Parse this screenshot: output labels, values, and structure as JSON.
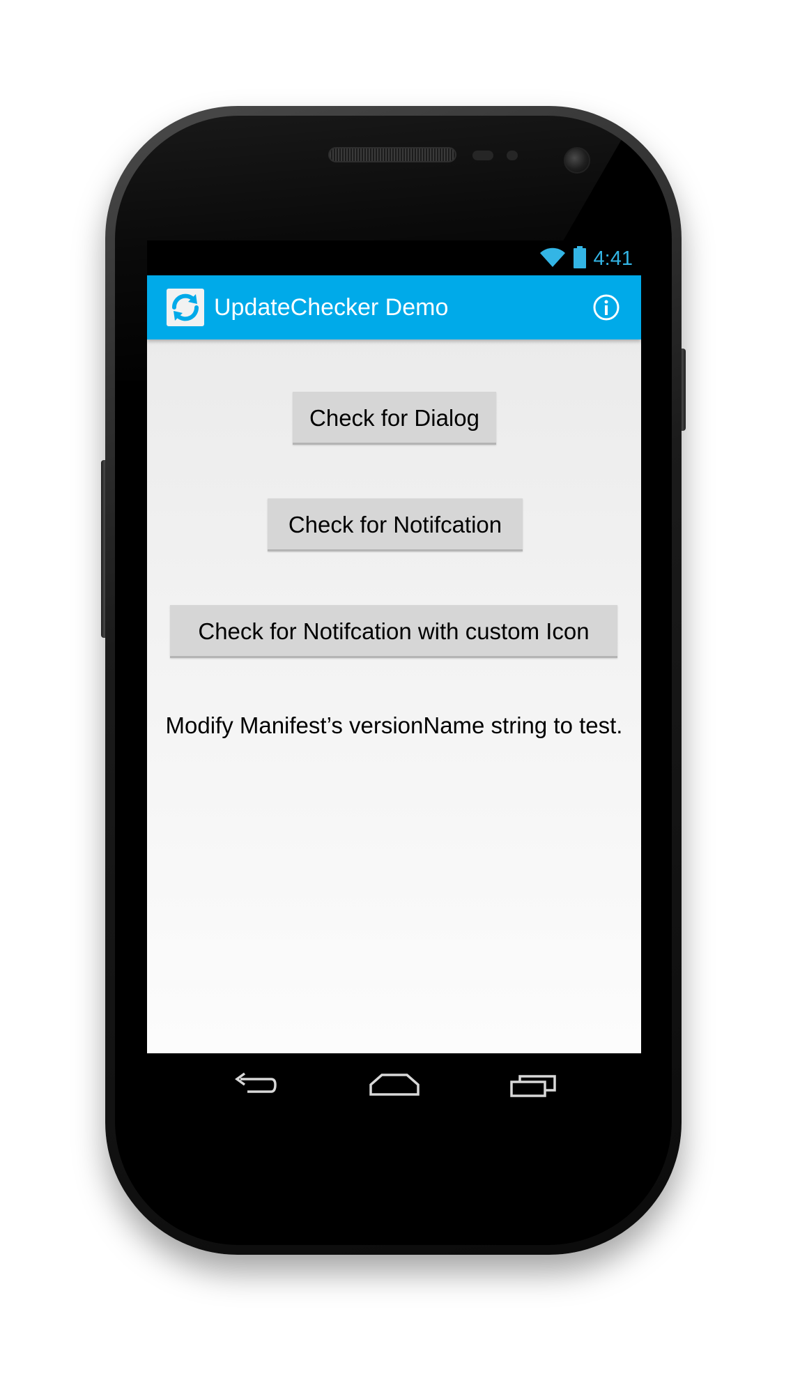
{
  "status_bar": {
    "time": "4:41",
    "icons": [
      "wifi-icon",
      "battery-icon"
    ],
    "accent_color": "#33b5e5"
  },
  "action_bar": {
    "title": "UpdateChecker Demo",
    "app_icon": "refresh-icon",
    "action_icon": "info-icon",
    "color": "#00aae9"
  },
  "main": {
    "buttons": [
      {
        "label": "Check for Dialog"
      },
      {
        "label": "Check for Notifcation"
      },
      {
        "label": "Check for Notifcation with custom Icon"
      }
    ],
    "hint": "Modify Manifest’s versionName string to test."
  },
  "nav_bar": {
    "icons": [
      "back-icon",
      "home-icon",
      "recent-apps-icon"
    ]
  }
}
